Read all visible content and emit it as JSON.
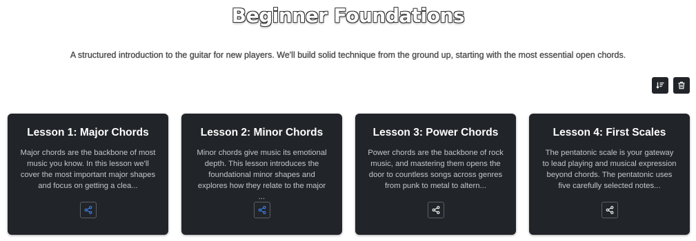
{
  "page": {
    "title": "Beginner Foundations",
    "subtitle": "A structured introduction to the guitar for new players. We'll build solid technique from the ground up, starting with the most essential open chords."
  },
  "toolbar": {
    "sort_icon": "sort-descending-icon",
    "delete_icon": "trash-icon"
  },
  "colors": {
    "card_bg": "#212428",
    "share_active": "#3b82f6",
    "share_default": "#ffffff"
  },
  "lessons": [
    {
      "title": "Lesson 1: Major Chords",
      "description": "Major chords are the backbone of most music you know. In this lesson we'll cover the most important major shapes and focus on getting a clea...",
      "share_icon": "share-icon",
      "share_active": true
    },
    {
      "title": "Lesson 2: Minor Chords",
      "description": "Minor chords give music its emotional depth. This lesson introduces the foundational minor shapes and explores how they relate to the major ...",
      "share_icon": "share-icon",
      "share_active": true
    },
    {
      "title": "Lesson 3: Power Chords",
      "description": "Power chords are the backbone of rock music, and mastering them opens the door to countless songs across genres from punk to metal to altern...",
      "share_icon": "share-icon",
      "share_active": false
    },
    {
      "title": "Lesson 4: First Scales",
      "description": "The pentatonic scale is your gateway to lead playing and musical expression beyond chords. The pentatonic uses five carefully selected notes...",
      "share_icon": "share-icon",
      "share_active": false
    }
  ]
}
